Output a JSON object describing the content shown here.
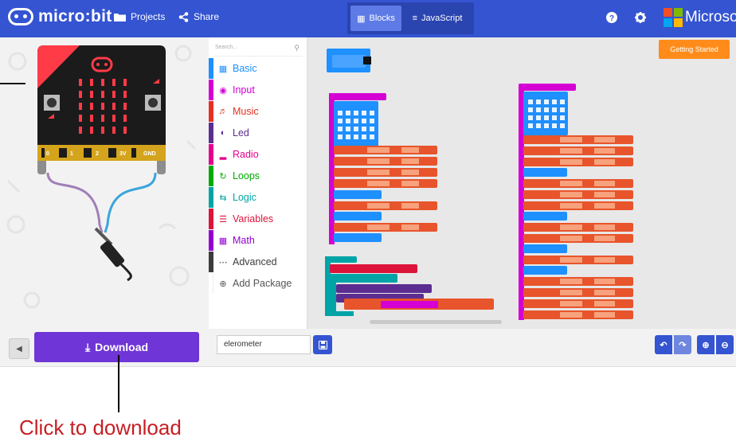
{
  "header": {
    "logo_text": "micro:bit",
    "projects_label": "Projects",
    "share_label": "Share",
    "blocks_label": "Blocks",
    "javascript_label": "JavaScript",
    "brand": "Microsoft",
    "help_icon": "help-icon",
    "settings_icon": "gear-icon"
  },
  "simulator": {
    "pins": [
      "0",
      "1",
      "2",
      "3V",
      "GND"
    ],
    "buttons": [
      "A",
      "B"
    ]
  },
  "toolbox": {
    "search_placeholder": "Search...",
    "categories": [
      {
        "label": "Basic",
        "color": "#1e90ff",
        "icon": "grid-icon"
      },
      {
        "label": "Input",
        "color": "#d400d4",
        "icon": "target-icon"
      },
      {
        "label": "Music",
        "color": "#e63022",
        "icon": "headphones-icon"
      },
      {
        "label": "Led",
        "color": "#5c2d91",
        "icon": "toggle-icon"
      },
      {
        "label": "Radio",
        "color": "#e3008c",
        "icon": "signal-icon"
      },
      {
        "label": "Loops",
        "color": "#00aa00",
        "icon": "refresh-icon"
      },
      {
        "label": "Logic",
        "color": "#00a4a6",
        "icon": "shuffle-icon"
      },
      {
        "label": "Variables",
        "color": "#dc143c",
        "icon": "list-icon"
      },
      {
        "label": "Math",
        "color": "#9400d3",
        "icon": "calculator-icon"
      },
      {
        "label": "Advanced",
        "color": "#3c3c3c",
        "icon": "ellipsis-icon"
      },
      {
        "label": "Add Package",
        "color": "#ffffff",
        "icon": "plus-circle-icon"
      }
    ]
  },
  "workspace": {
    "getting_started": "Getting Started"
  },
  "bottom": {
    "download_label": "Download",
    "project_name": "elerometer"
  },
  "annotation": {
    "text": "Click to download"
  },
  "colors": {
    "header": "#3454d1",
    "download": "#6f35d6",
    "getting_started": "#ff8c1a",
    "annotation": "#c51f24"
  }
}
